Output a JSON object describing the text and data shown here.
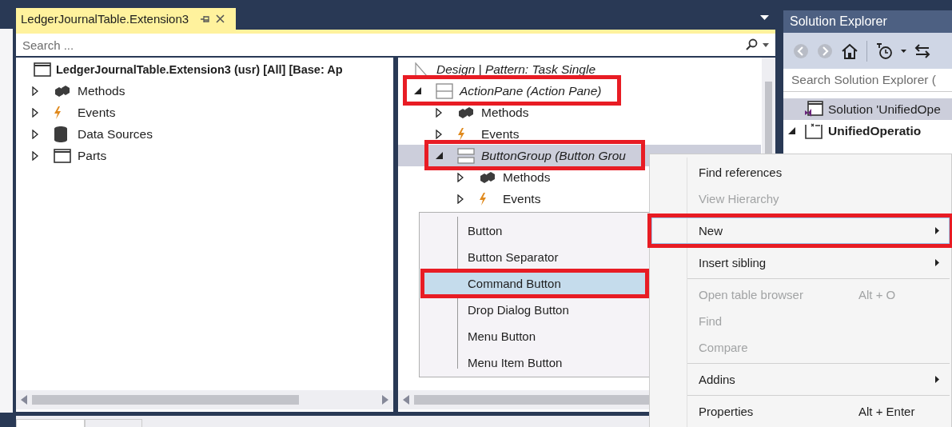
{
  "document_tab": {
    "title": "LedgerJournalTable.Extension3",
    "selected": true
  },
  "search": {
    "placeholder": "Search ..."
  },
  "left_tree": {
    "root": {
      "label": "LedgerJournalTable.Extension3 (usr) [All] [Base: Ap",
      "kind": "window"
    },
    "nodes": [
      {
        "label": "Methods",
        "kind": "methods",
        "expanded": false,
        "selected": false,
        "highlighted": false
      },
      {
        "label": "Events",
        "kind": "events",
        "expanded": false,
        "selected": false,
        "highlighted": false
      },
      {
        "label": "Data Sources",
        "kind": "data-sources",
        "expanded": false,
        "selected": false,
        "highlighted": false
      },
      {
        "label": "Parts",
        "kind": "window",
        "expanded": false,
        "selected": false,
        "highlighted": false
      }
    ]
  },
  "right_tree": {
    "header": {
      "label": "Design | Pattern: Task Single",
      "kind": "design"
    },
    "nodes": [
      {
        "label": "ActionPane (Action Pane)",
        "kind": "action-pane",
        "expanded": true,
        "selected": false,
        "highlighted": true,
        "children": [
          {
            "label": "Methods",
            "kind": "methods",
            "expanded": false,
            "selected": false,
            "highlighted": false
          },
          {
            "label": "Events",
            "kind": "events",
            "expanded": false,
            "selected": false,
            "highlighted": false
          },
          {
            "label": "ButtonGroup (Button Grou",
            "kind": "button-group",
            "expanded": true,
            "selected": true,
            "highlighted": true,
            "children": [
              {
                "label": "Methods",
                "kind": "methods",
                "expanded": false,
                "selected": false,
                "highlighted": false
              },
              {
                "label": "Events",
                "kind": "events",
                "expanded": false,
                "selected": false,
                "highlighted": false
              }
            ]
          }
        ]
      }
    ]
  },
  "context_menu": {
    "items": [
      {
        "kind": "item",
        "label": "Find references",
        "disabled": false,
        "submenu": false,
        "selected": false,
        "highlighted": false
      },
      {
        "kind": "item",
        "label": "View Hierarchy",
        "disabled": true,
        "submenu": false,
        "selected": false,
        "highlighted": false
      },
      {
        "kind": "separator"
      },
      {
        "kind": "item",
        "label": "New",
        "disabled": false,
        "submenu": true,
        "selected": true,
        "highlighted": true
      },
      {
        "kind": "separator"
      },
      {
        "kind": "item",
        "label": "Insert sibling",
        "disabled": false,
        "submenu": true,
        "selected": false,
        "highlighted": false
      },
      {
        "kind": "separator"
      },
      {
        "kind": "item",
        "label": "Open table browser",
        "shortcut": "Alt + O",
        "disabled": true,
        "submenu": false,
        "selected": false,
        "highlighted": false
      },
      {
        "kind": "item",
        "label": "Find",
        "disabled": true,
        "submenu": false,
        "selected": false,
        "highlighted": false
      },
      {
        "kind": "item",
        "label": "Compare",
        "disabled": true,
        "submenu": false,
        "selected": false,
        "highlighted": false
      },
      {
        "kind": "separator"
      },
      {
        "kind": "item",
        "label": "Addins",
        "disabled": false,
        "submenu": true,
        "selected": false,
        "highlighted": false
      },
      {
        "kind": "separator"
      },
      {
        "kind": "item",
        "label": "Properties",
        "shortcut": "Alt + Enter",
        "disabled": false,
        "submenu": false,
        "selected": false,
        "highlighted": false
      }
    ]
  },
  "submenu": {
    "items": [
      {
        "label": "Button",
        "selected": false,
        "highlighted": false
      },
      {
        "label": "Button Separator",
        "selected": false,
        "highlighted": false
      },
      {
        "label": "Command Button",
        "selected": true,
        "highlighted": true
      },
      {
        "label": "Drop Dialog Button",
        "selected": false,
        "highlighted": false
      },
      {
        "label": "Menu Button",
        "selected": false,
        "highlighted": false
      },
      {
        "label": "Menu Item Button",
        "selected": false,
        "highlighted": false
      }
    ]
  },
  "solution_explorer": {
    "title": "Solution Explorer",
    "search": {
      "placeholder": "Search Solution Explorer ("
    },
    "nodes": [
      {
        "label": "Solution 'UnifiedOpe",
        "kind": "solution",
        "selected": true,
        "bold": false
      },
      {
        "label": "UnifiedOperatio",
        "kind": "project",
        "expanded": true,
        "selected": false,
        "bold": true
      }
    ]
  }
}
